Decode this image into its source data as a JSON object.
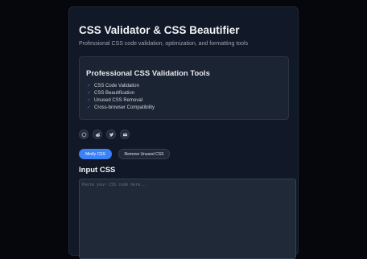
{
  "header": {
    "title": "CSS Validator & CSS Beautifier",
    "subtitle": "Professional CSS code validation, optimization, and formatting tools"
  },
  "tools": {
    "title": "Professional CSS Validation Tools",
    "check_icon": "✓",
    "features": [
      "CSS Code Validation",
      "CSS Beautification",
      "Unused CSS Removal",
      "Cross-browser Compatibility"
    ]
  },
  "social": [
    "github-icon",
    "reddit-icon",
    "twitter-icon",
    "email-icon"
  ],
  "actions": {
    "minify_label": "Minify CSS",
    "remove_unused_label": "Remove Unused CSS"
  },
  "input": {
    "label": "Input CSS",
    "placeholder": "Paste your CSS code here..."
  },
  "colors": {
    "accent": "#3b82f6",
    "background": "#05070d",
    "card": "#111827"
  }
}
